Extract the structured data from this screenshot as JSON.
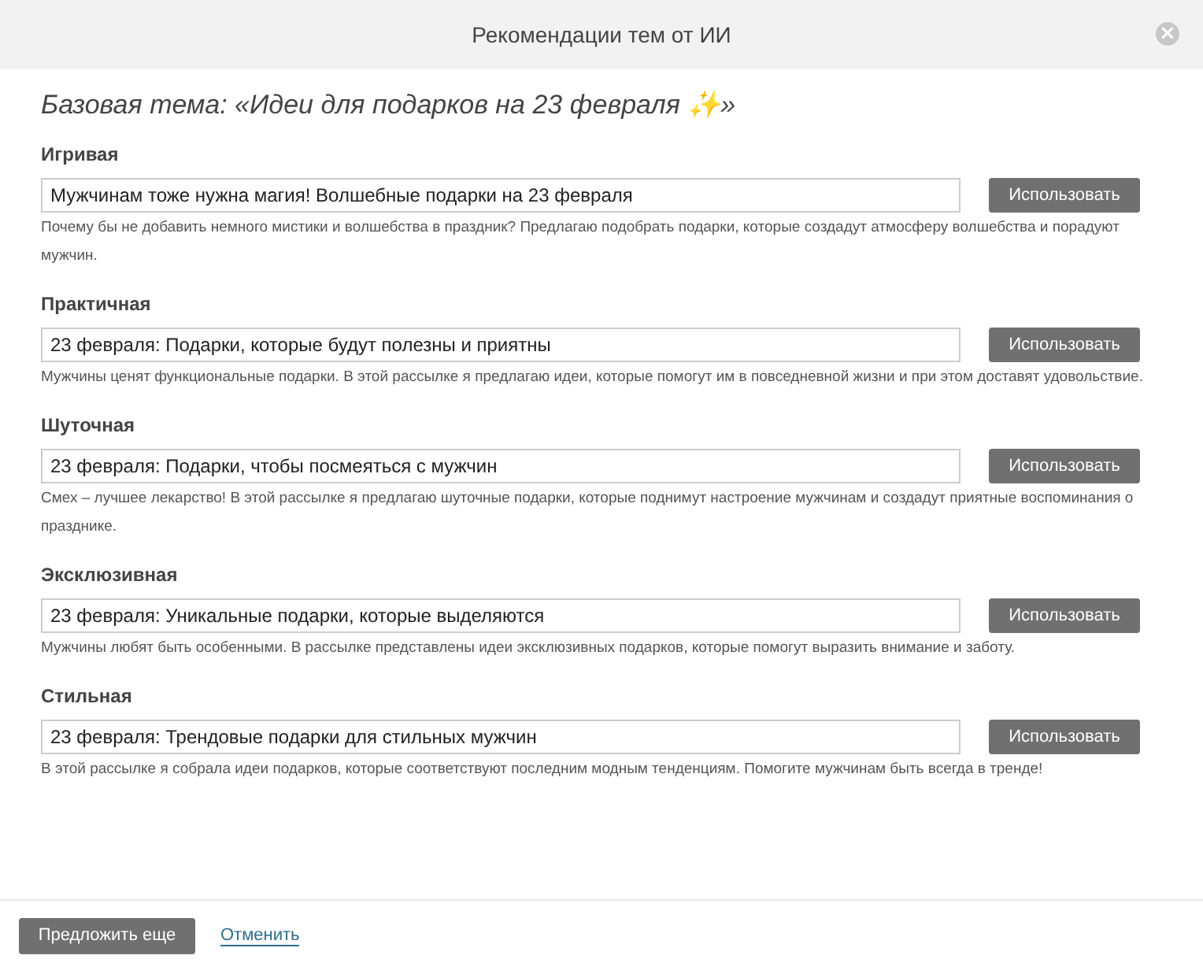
{
  "dialog": {
    "title": "Рекомендации тем от ИИ",
    "close": "×"
  },
  "base_topic": "Базовая тема: «Идеи для подарков на 23 февраля ✨»",
  "suggestions": [
    {
      "label": "Игривая",
      "value": "Мужчинам тоже нужна магия! Волшебные подарки на 23 февраля",
      "button": "Использовать",
      "description": "Почему бы не добавить немного мистики и волшебства в праздник? Предлагаю подобрать подарки, которые создадут атмосферу волшебства и порадуют мужчин."
    },
    {
      "label": "Практичная",
      "value": "23 февраля: Подарки, которые будут полезны и приятны",
      "button": "Использовать",
      "description": "Мужчины ценят функциональные подарки. В этой рассылке я предлагаю идеи, которые помогут им в повседневной жизни и при этом доставят удовольствие."
    },
    {
      "label": "Шуточная",
      "value": "23 февраля: Подарки, чтобы посмеяться с мужчин",
      "button": "Использовать",
      "description": "Смех – лучшее лекарство! В этой рассылке я предлагаю шуточные подарки, которые поднимут настроение мужчинам и создадут приятные воспоминания о празднике."
    },
    {
      "label": "Эксклюзивная",
      "value": "23 февраля: Уникальные подарки, которые выделяются",
      "button": "Использовать",
      "description": "Мужчины любят быть особенными. В рассылке представлены идеи эксклюзивных подарков, которые помогут выразить внимание и заботу."
    },
    {
      "label": "Стильная",
      "value": "23 февраля: Трендовые подарки для стильных мужчин",
      "button": "Использовать",
      "description": "В этой рассылке я собрала идеи подарков, которые соответствуют последним модным тенденциям. Помогите мужчинам быть всегда в тренде!"
    }
  ],
  "footer": {
    "primary_button": "Предложить еще",
    "cancel_link": "Отменить"
  }
}
